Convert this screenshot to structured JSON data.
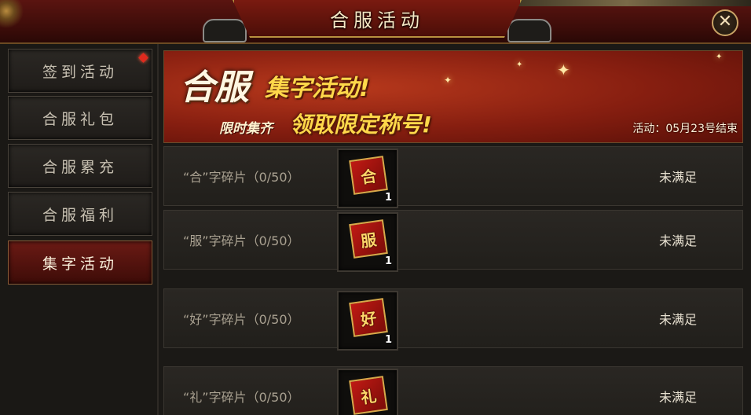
{
  "window": {
    "title": "合服活动"
  },
  "sidebar": {
    "items": [
      {
        "label": "签到活动",
        "active": false,
        "has_alert": true
      },
      {
        "label": "合服礼包",
        "active": false,
        "has_alert": false
      },
      {
        "label": "合服累充",
        "active": false,
        "has_alert": false
      },
      {
        "label": "合服福利",
        "active": false,
        "has_alert": false
      },
      {
        "label": "集字活动",
        "active": true,
        "has_alert": false
      }
    ]
  },
  "banner": {
    "title_a": "合服",
    "title_b": "集字活动!",
    "sub_a": "限时集齐",
    "sub_b": "领取限定称号!",
    "date_text": "活动：05月23号结束"
  },
  "rows": [
    {
      "label": "“合”字碎片（0/50）",
      "icon_char": "合",
      "count": "1",
      "status": "未满足"
    },
    {
      "label": "“服”字碎片（0/50）",
      "icon_char": "服",
      "count": "1",
      "status": "未满足"
    },
    {
      "label": "“好”字碎片（0/50）",
      "icon_char": "好",
      "count": "1",
      "status": "未满足"
    },
    {
      "label": "“礼”字碎片（0/50）",
      "icon_char": "礼",
      "count": "",
      "status": "未满足"
    }
  ],
  "icons": {
    "close": "close-icon",
    "alert": "red-diamond-icon",
    "fragment": "red-scroll-icon"
  },
  "colors": {
    "accent_red": "#6b1a14",
    "gold": "#d9a94a",
    "status_text": "#e9e2d2"
  }
}
